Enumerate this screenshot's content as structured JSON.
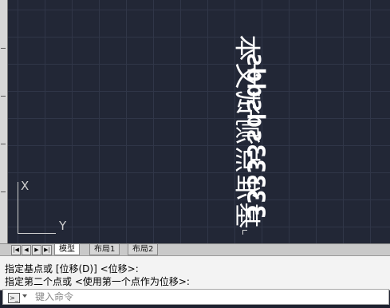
{
  "canvas": {
    "text_chinese": "基准点测试文本",
    "text_latin": "33333sdsdds",
    "ucs_x": "X",
    "ucs_y": "Y"
  },
  "tabs": {
    "nav_first": "|◀",
    "nav_prev": "◀",
    "nav_next": "▶",
    "nav_last": "▶|",
    "items": [
      "模型",
      "布局1",
      "布局2"
    ],
    "active": "模型"
  },
  "command": {
    "history": [
      "指定基点或 [位移(D)] <位移>:",
      "指定第二个点或 <使用第一个点作为位移>:"
    ],
    "input_placeholder": "键入命令",
    "prompt_icon": "prompt-icon",
    "dropdown_icon": "chevron-down-icon"
  },
  "colors": {
    "canvas_bg": "#222736",
    "grid": "#303648",
    "text": "#ffffff"
  }
}
